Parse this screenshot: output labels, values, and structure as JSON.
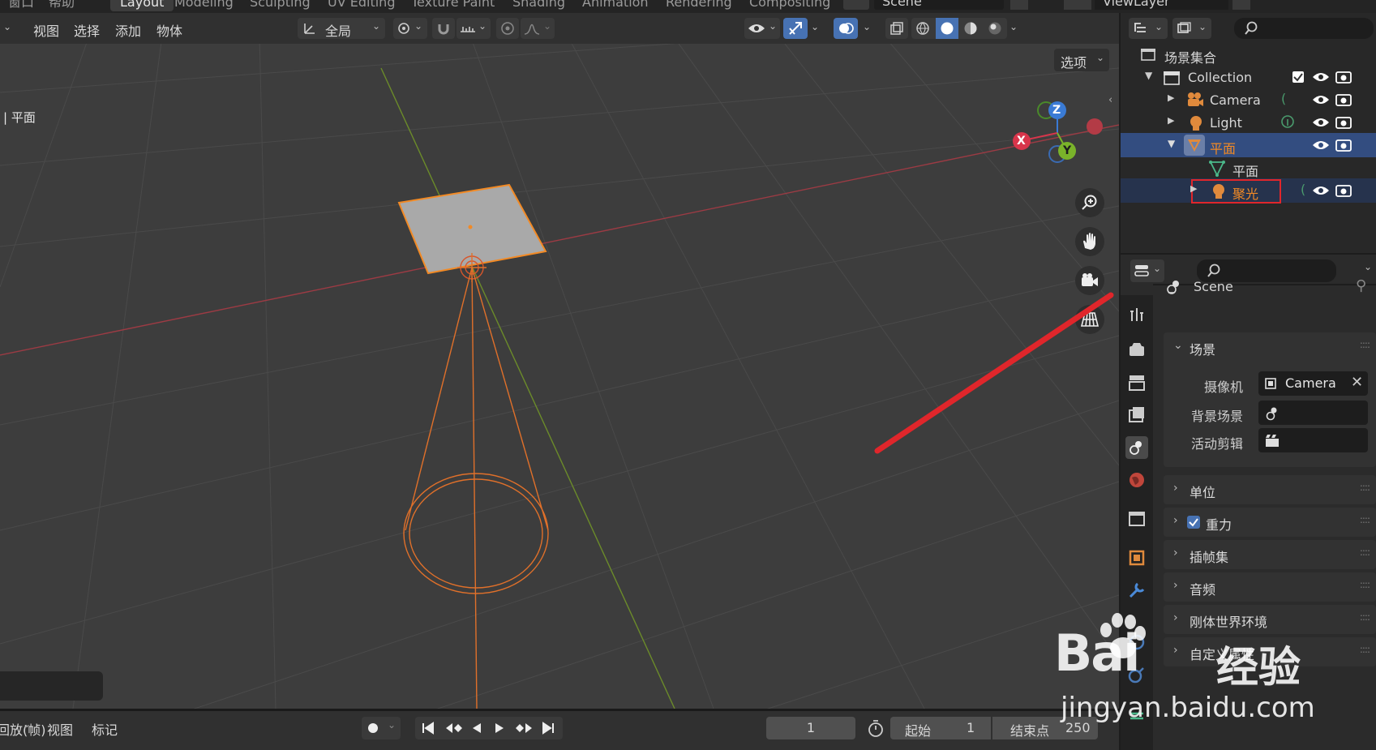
{
  "workspace_tabs": [
    "窗口",
    "帮助",
    "Layout",
    "Modeling",
    "Sculpting",
    "UV Editing",
    "Texture Paint",
    "Shading",
    "Animation",
    "Rendering",
    "Compositing"
  ],
  "scene_name": "Scene",
  "viewlayer_name": "ViewLayer",
  "viewport_menu": {
    "view": "视图",
    "select": "选择",
    "add": "添加",
    "object": "物体"
  },
  "transform_orientation": "全局",
  "options_label": "选项",
  "viewport_object_label": "| 平面",
  "gizmo": {
    "z": "Z",
    "x": "X",
    "y": "Y"
  },
  "outliner": {
    "scene_collection": "场景集合",
    "collection": "Collection",
    "camera": "Camera",
    "light": "Light",
    "plane": "平面",
    "plane_mesh": "平面",
    "spot": "聚光"
  },
  "properties": {
    "scene_title": "Scene",
    "scene_panel": "场景",
    "camera_label": "摄像机",
    "camera_value": "Camera",
    "background_label": "背景场景",
    "clip_label": "活动剪辑",
    "panels": [
      "单位",
      "重力",
      "插帧集",
      "音频",
      "刚体世界环境",
      "自定义属性"
    ]
  },
  "timeline": {
    "playback_label": "回放(帧)",
    "view": "视图",
    "marker": "标记",
    "current_frame": "1",
    "start_label": "起始",
    "start_value": "1",
    "end_label": "结束点",
    "end_value": "250"
  },
  "watermark": {
    "text1": "Bai",
    "text2": "经验",
    "url": "jingyan.baidu.com"
  },
  "colors": {
    "selected_orange": "#f28a25",
    "annotation_red": "#e0262b",
    "highlight_blue": "#334d80"
  }
}
